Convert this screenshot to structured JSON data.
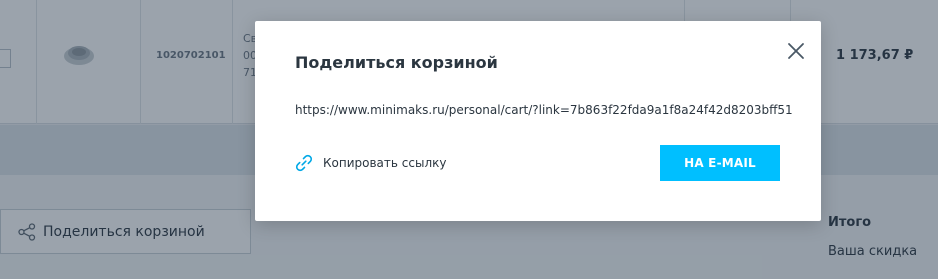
{
  "background": {
    "cart_row": {
      "sku": "1020702101",
      "desc_lines": [
        "Св",
        "00",
        "71"
      ],
      "price": "1 173,67 ₽"
    },
    "share_button_label": "Поделиться корзиной",
    "totals": {
      "title": "Итого",
      "discount_label": "Ваша скидка"
    }
  },
  "modal": {
    "title": "Поделиться корзиной",
    "link_url": "https://www.minimaks.ru/personal/cart/?link=7b863f22fda9a1f8a24f42d8203bff51",
    "copy_label": "Копировать ссылку",
    "email_button_label": "НА E-MAIL"
  },
  "colors": {
    "accent": "#00bfff",
    "overlay": "rgba(34,52,70,0.45)"
  },
  "icons": {
    "close": "close-icon",
    "copy": "link-icon",
    "share": "share-icon"
  }
}
